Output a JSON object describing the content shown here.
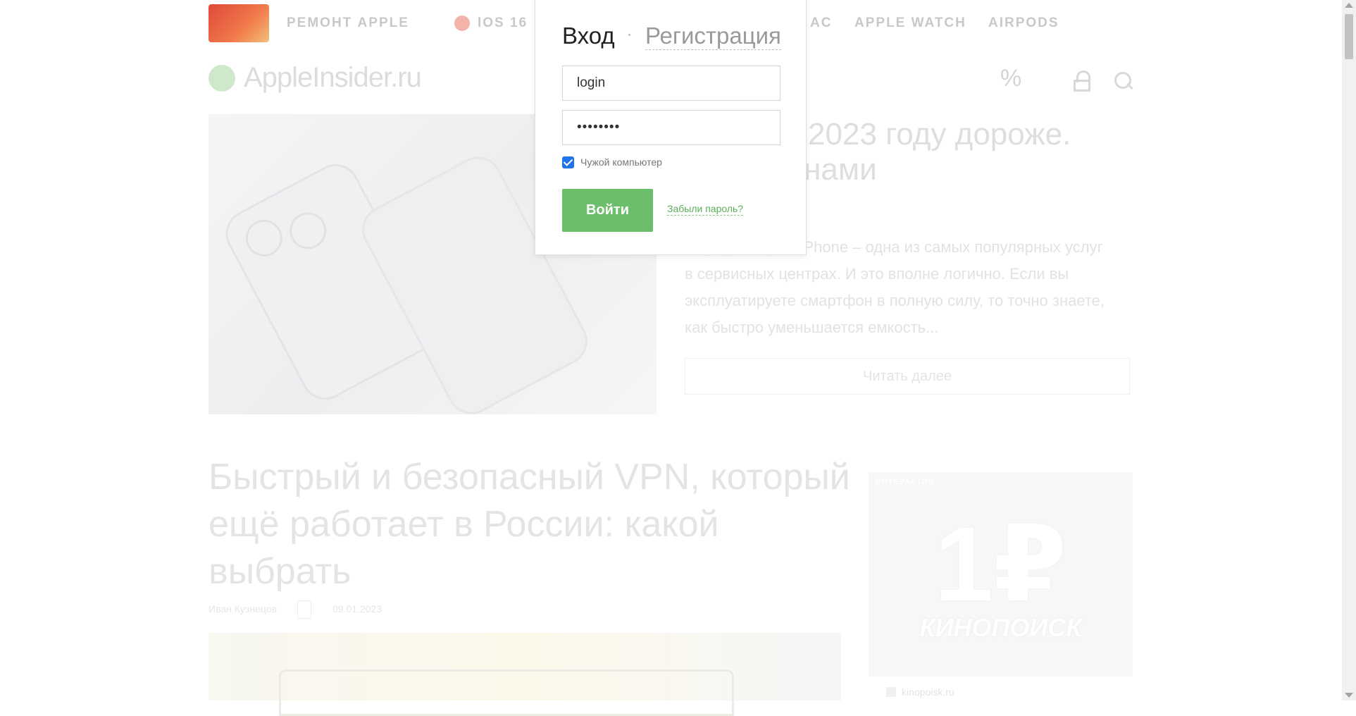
{
  "topnav": {
    "items": [
      "РЕМОНТ APPLE",
      "IOS 16",
      "AC",
      "APPLE WATCH",
      "AIRPODS"
    ]
  },
  "header": {
    "logo": "AppleInsider.ru",
    "icons": [
      "percent-icon",
      "lock-icon",
      "search-icon"
    ]
  },
  "hero": {
    "title": "Phone в 2023 году дороже. Что с ценами",
    "excerpt": "аккумулятора в iPhone – одна из самых популярных услуг в сервисных центрах. И это вполне логично. Если вы эксплуатируете смартфон в полную силу, то точно знаете, как быстро уменьшается емкость...",
    "read_more": "Читать далее"
  },
  "article": {
    "title": "Быстрый и безопасный VPN, который ещё работает в России: какой выбрать",
    "author": "Иван Кузнецов",
    "date": "09.01.2023"
  },
  "ad": {
    "label": "ИНТЕРАКТИВ",
    "big": "1₽",
    "brand": "КИНОПОИСК",
    "caption": "kinopoisk.ru"
  },
  "modal": {
    "tab_login": "Вход",
    "tab_register": "Регистрация",
    "login_value": "login",
    "password_value": "••••••••",
    "checkbox_label": "Чужой компьютер",
    "checkbox_checked": true,
    "submit_label": "Войти",
    "forgot_label": "Забыли пароль?"
  },
  "colors": {
    "accent_green": "#6cbf6a",
    "checkbox_blue": "#1e74e8"
  }
}
